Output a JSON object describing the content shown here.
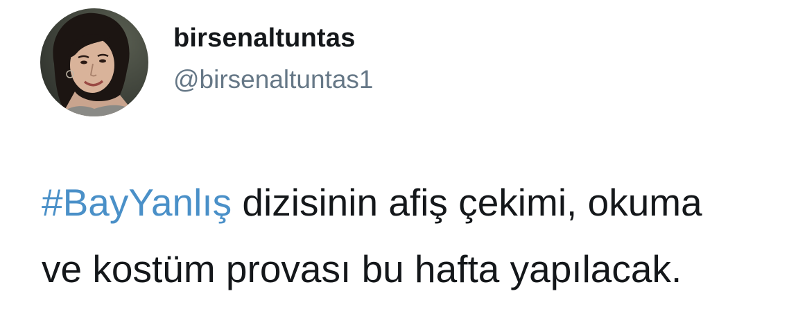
{
  "author": {
    "display_name": "birsenaltuntas",
    "handle": "@birsenaltuntas1"
  },
  "tweet": {
    "hashtag": "#BayYanlış",
    "line1_rest": " dizisinin afiş çekimi, okuma",
    "line2": "ve kostüm provası bu hafta yapılacak."
  },
  "colors": {
    "hashtag": "#4a90c8",
    "text": "#14171a",
    "handle": "#657786"
  }
}
